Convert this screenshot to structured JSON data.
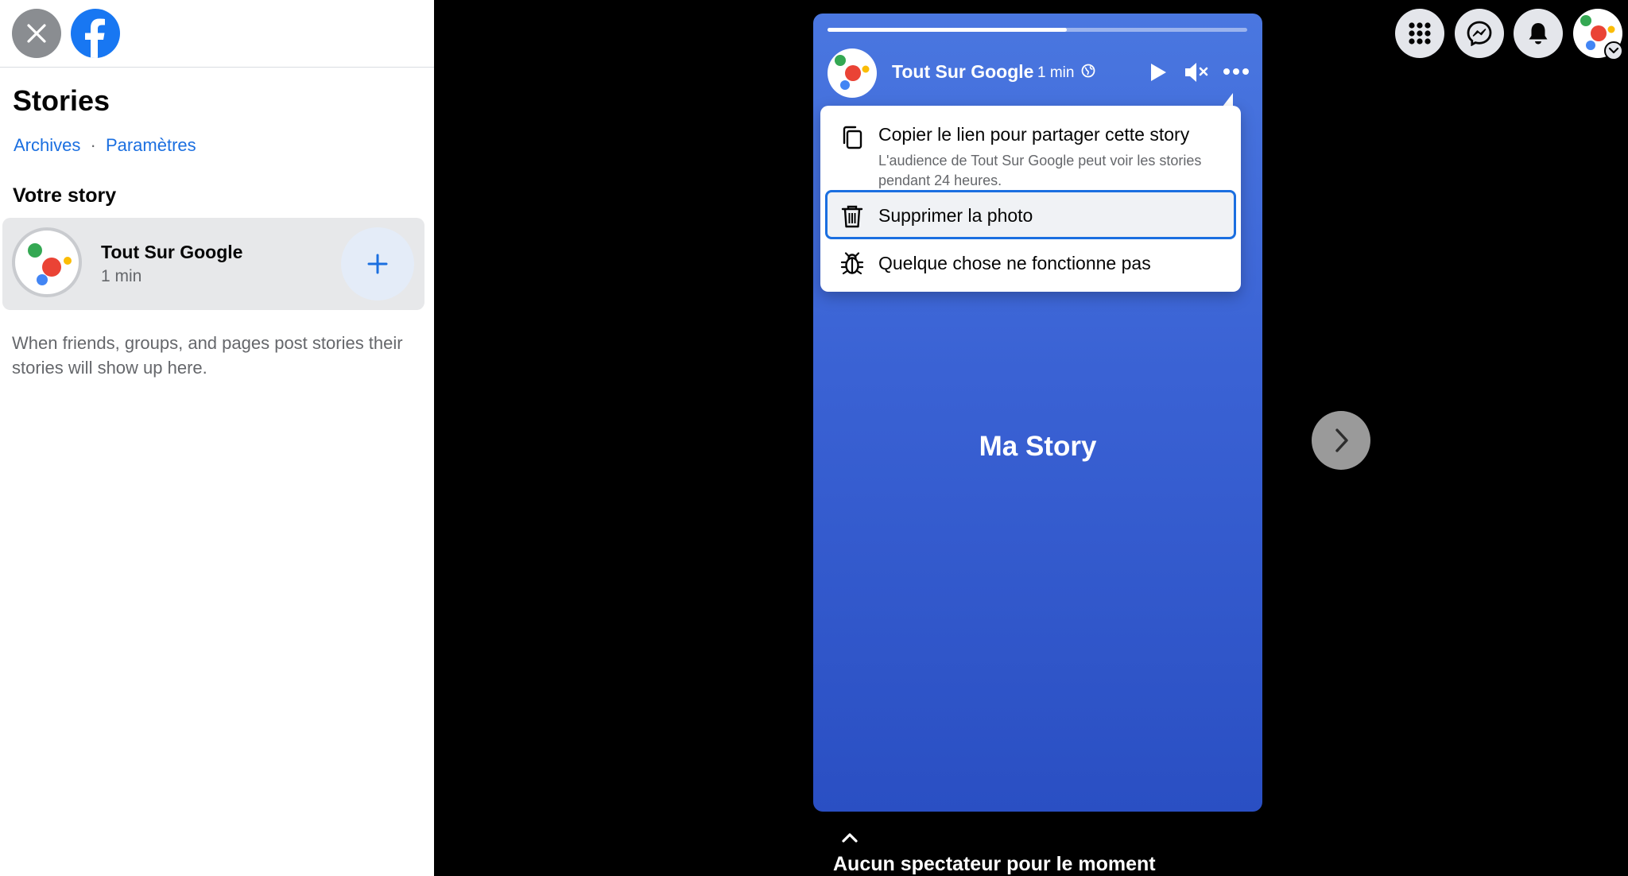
{
  "sidebar": {
    "title": "Stories",
    "links": {
      "archives": "Archives",
      "separator": "·",
      "settings": "Paramètres"
    },
    "your_story_heading": "Votre story",
    "story_card": {
      "name": "Tout Sur Google",
      "time": "1 min"
    },
    "empty_message": "When friends, groups, and pages post stories their stories will show up here."
  },
  "story": {
    "author": "Tout Sur Google",
    "time": "1 min",
    "caption": "Ma Story",
    "progress": 0.57
  },
  "menu": {
    "copy_link": {
      "title": "Copier le lien pour partager cette story",
      "subtitle": "L'audience de Tout Sur Google peut voir les stories pendant 24 heures."
    },
    "delete": {
      "title": "Supprimer la photo"
    },
    "report": {
      "title": "Quelque chose ne fonctionne pas"
    }
  },
  "viewers": {
    "text": "Aucun spectateur pour le moment"
  },
  "icons": {
    "close": "close-icon",
    "facebook": "facebook-logo-icon",
    "menu_grid": "grid-menu-icon",
    "messenger": "messenger-icon",
    "notifications": "bell-icon",
    "profile": "profile-avatar-icon",
    "add": "plus-icon",
    "play": "play-icon",
    "mute": "mute-icon",
    "more": "more-options-icon",
    "globe": "globe-icon",
    "copy": "copy-icon",
    "trash": "trash-icon",
    "bug": "bug-icon",
    "next": "chevron-right-icon",
    "up": "chevron-up-icon"
  },
  "colors": {
    "accent": "#1b6fe0",
    "facebook_blue": "#1877f2",
    "story_gradient_top": "#4a77e0",
    "story_gradient_bottom": "#2a4fc3"
  }
}
